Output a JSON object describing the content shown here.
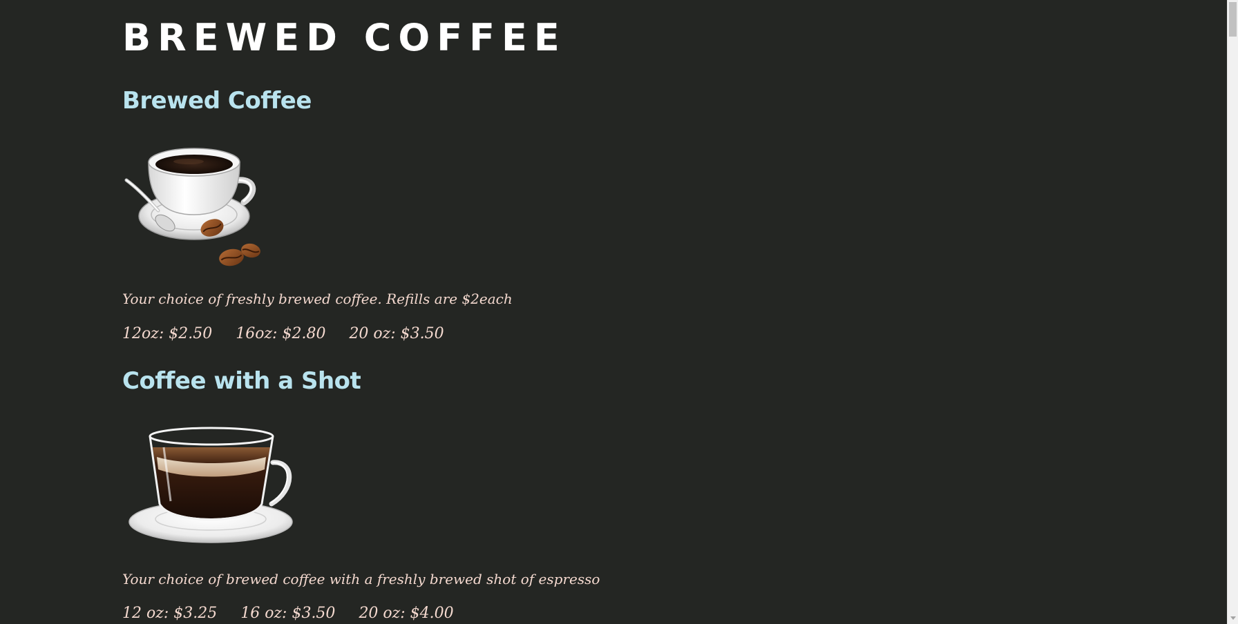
{
  "page": {
    "title": "BREWED COFFEE"
  },
  "sections": [
    {
      "title": "Brewed Coffee",
      "image_alt": "cup of black coffee on saucer with spoon and coffee beans",
      "description": "Your choice of freshly brewed coffee. Refills are $2each",
      "prices": [
        "12oz: $2.50",
        "16oz: $2.80",
        "20 oz: $3.50"
      ]
    },
    {
      "title": "Coffee with a Shot",
      "image_alt": "glass cup of coffee with crema on saucer",
      "description": "Your choice of brewed coffee with a freshly brewed shot of espresso",
      "prices": [
        "12 oz: $3.25",
        "16 oz: $3.50",
        "20 oz: $4.00"
      ]
    }
  ],
  "colors": {
    "background": "#242623",
    "title": "#ffffff",
    "section_title": "#b9e3ee",
    "body_text": "#f4d9cf"
  }
}
